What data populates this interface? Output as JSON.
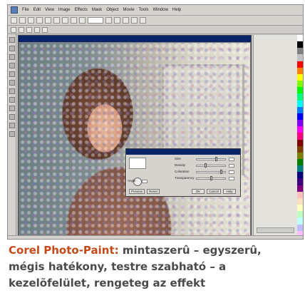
{
  "app": {
    "menu": [
      "File",
      "Edit",
      "View",
      "Image",
      "Effects",
      "Mask",
      "Object",
      "Movie",
      "Tools",
      "Window",
      "Help"
    ]
  },
  "dialog": {
    "labels": {
      "l1": "Size",
      "l2": "Density",
      "l3": "Coloration",
      "l4": "Transparency",
      "l5": "Angle"
    },
    "buttons": {
      "preview": "Preview",
      "reset": "Reset",
      "ok": "OK",
      "cancel": "Cancel",
      "help": "Help"
    }
  },
  "caption": {
    "brand": "Corel Photo-Paint:",
    "text": " mintaszerû – egysze­rû, mégis hatékony, testre szabható – a kezelõfelület, rengeteg az effekt"
  },
  "colors": {
    "caption_brand": "#c64a19",
    "caption_text": "#4a4a4a",
    "titlebar": "#0a246a",
    "palette": [
      "#ffffff",
      "#000000",
      "#7f7f7f",
      "#c0c0c0",
      "#ff0000",
      "#ff7f00",
      "#ffff00",
      "#7fff00",
      "#00ff00",
      "#00ff7f",
      "#00ffff",
      "#007fff",
      "#0000ff",
      "#7f00ff",
      "#ff00ff",
      "#ff007f",
      "#7f0000",
      "#7f3f00",
      "#7f7f00",
      "#007f00",
      "#007f7f",
      "#00007f",
      "#3f007f",
      "#7f007f",
      "#ffbfbf",
      "#ffdfbf",
      "#ffffbf",
      "#bfffbf",
      "#bfffff",
      "#bfbfff",
      "#ffbfff"
    ]
  }
}
